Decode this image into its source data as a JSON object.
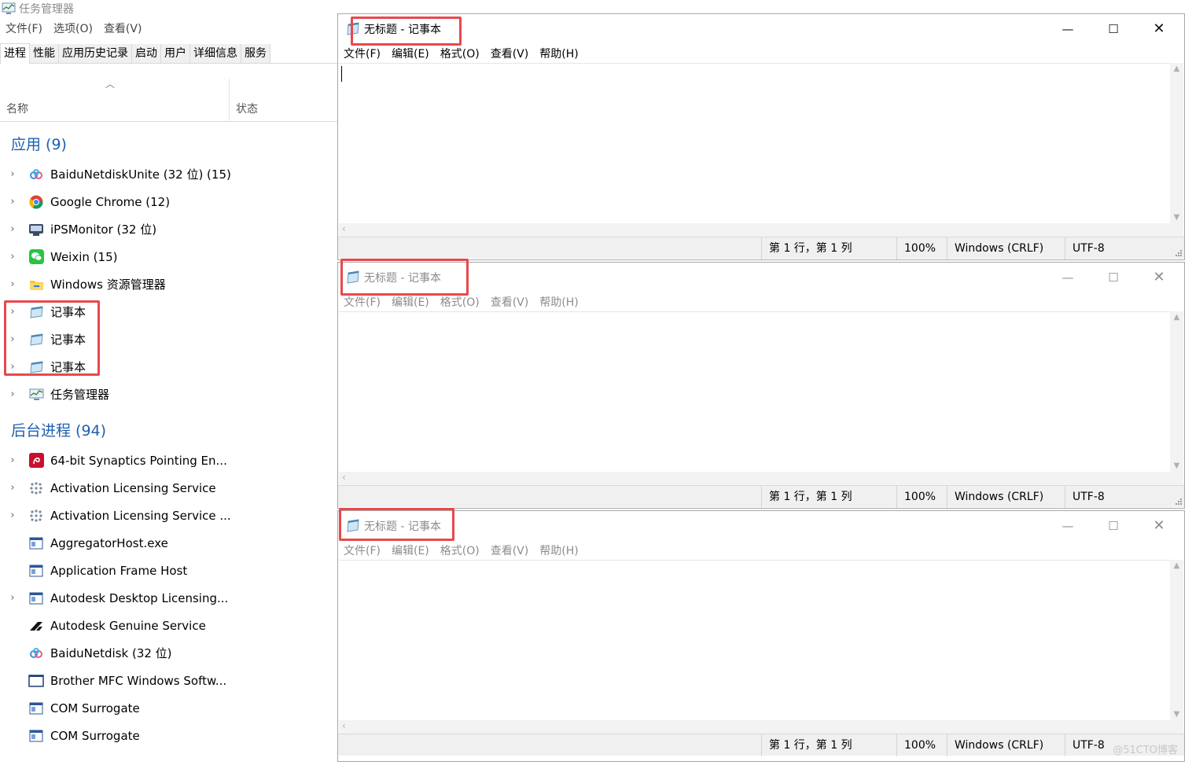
{
  "task_manager": {
    "title": "任务管理器",
    "menu": [
      "文件(F)",
      "选项(O)",
      "查看(V)"
    ],
    "tabs": [
      "进程",
      "性能",
      "应用历史记录",
      "启动",
      "用户",
      "详细信息",
      "服务"
    ],
    "active_tab": "进程",
    "columns": {
      "name": "名称",
      "status": "状态"
    },
    "apps_group": "应用 (9)",
    "apps": [
      {
        "label": "BaiduNetdiskUnite (32 位) (15)",
        "icon": "baidu-netdisk-icon"
      },
      {
        "label": "Google Chrome (12)",
        "icon": "chrome-icon"
      },
      {
        "label": "iPSMonitor (32 位)",
        "icon": "ipsmonitor-icon"
      },
      {
        "label": "Weixin (15)",
        "icon": "weixin-icon"
      },
      {
        "label": "Windows 资源管理器",
        "icon": "folder-icon"
      },
      {
        "label": "记事本",
        "icon": "notepad-icon"
      },
      {
        "label": "记事本",
        "icon": "notepad-icon"
      },
      {
        "label": "记事本",
        "icon": "notepad-icon"
      },
      {
        "label": "任务管理器",
        "icon": "task-manager-icon"
      }
    ],
    "bg_group": "后台进程 (94)",
    "background": [
      {
        "label": "64-bit Synaptics Pointing En...",
        "icon": "synaptics-icon",
        "expandable": true
      },
      {
        "label": "Activation Licensing Service",
        "icon": "service-dots-icon",
        "expandable": true
      },
      {
        "label": "Activation Licensing Service ...",
        "icon": "service-dots-icon",
        "expandable": true
      },
      {
        "label": "AggregatorHost.exe",
        "icon": "app-window-icon",
        "expandable": false
      },
      {
        "label": "Application Frame Host",
        "icon": "app-window-icon",
        "expandable": false
      },
      {
        "label": "Autodesk Desktop Licensing...",
        "icon": "app-window-icon",
        "expandable": true
      },
      {
        "label": "Autodesk Genuine Service",
        "icon": "autodesk-icon",
        "expandable": false
      },
      {
        "label": "BaiduNetdisk (32 位)",
        "icon": "baidu-netdisk-icon",
        "expandable": false
      },
      {
        "label": "Brother MFC Windows Softw...",
        "icon": "window-outline-icon",
        "expandable": false
      },
      {
        "label": "COM Surrogate",
        "icon": "app-window-icon",
        "expandable": false
      },
      {
        "label": "COM Surrogate",
        "icon": "app-window-icon",
        "expandable": false
      }
    ]
  },
  "notepads": [
    {
      "caption": "无标题 - 记事本",
      "menu": [
        "文件(F)",
        "编辑(E)",
        "格式(O)",
        "查看(V)",
        "帮助(H)"
      ],
      "status": {
        "position": "第 1 行，第 1 列",
        "zoom": "100%",
        "eol": "Windows (CRLF)",
        "encoding": "UTF-8"
      }
    },
    {
      "caption": "无标题 - 记事本",
      "menu": [
        "文件(F)",
        "编辑(E)",
        "格式(O)",
        "查看(V)",
        "帮助(H)"
      ],
      "status": {
        "position": "第 1 行，第 1 列",
        "zoom": "100%",
        "eol": "Windows (CRLF)",
        "encoding": "UTF-8"
      }
    },
    {
      "caption": "无标题 - 记事本",
      "menu": [
        "文件(F)",
        "编辑(E)",
        "格式(O)",
        "查看(V)",
        "帮助(H)"
      ],
      "status": {
        "position": "第 1 行，第 1 列",
        "zoom": "100%",
        "eol": "Windows (CRLF)",
        "encoding": "UTF-8"
      }
    }
  ],
  "window_controls": {
    "minimize": "—",
    "maximize": "☐",
    "close": "✕"
  },
  "watermark": "@51CTO博客",
  "colors": {
    "highlight": "#e8494c",
    "group_header": "#1c5fb0"
  }
}
